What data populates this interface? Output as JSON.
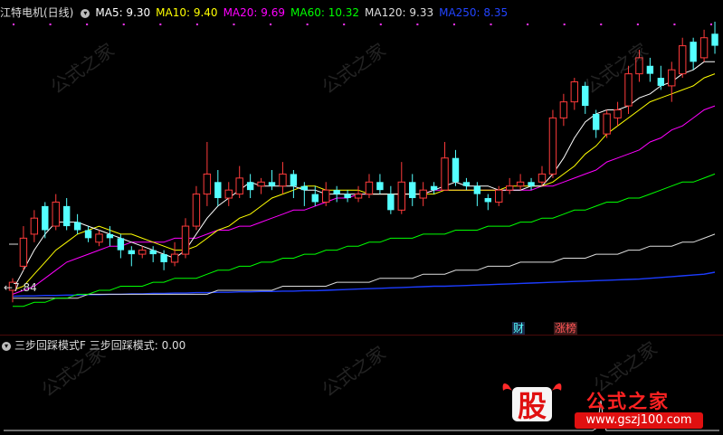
{
  "title": "江特电机(日线)",
  "ma_legend": [
    {
      "label": "MA5: 9.30",
      "color": "#ffffff"
    },
    {
      "label": "MA10: 9.40",
      "color": "#ffff00"
    },
    {
      "label": "MA20: 9.69",
      "color": "#ff00ff"
    },
    {
      "label": "MA60: 10.32",
      "color": "#00ff00"
    },
    {
      "label": "MA120: 9.33",
      "color": "#dddddd"
    },
    {
      "label": "MA250: 8.35",
      "color": "#1c3cff"
    }
  ],
  "low_label": "7.84",
  "markers": {
    "cai": "财",
    "zhang": "涨榜"
  },
  "sub": {
    "name": "三步回踩模式F",
    "label": "三步回踩模式: 0.00"
  },
  "brand": {
    "logo": "股",
    "name": "公式之家",
    "url": "www.gszj100.com"
  },
  "watermark": {
    "main": "公式之家",
    "sub": "www.gszj100.com"
  },
  "chart_data": {
    "type": "candlestick",
    "ylim": [
      7.2,
      14.6
    ],
    "colors": {
      "up": "#ff3b3b",
      "down": "#54ffff",
      "ma5": "#ffffff",
      "ma10": "#ffff00",
      "ma20": "#ff00ff",
      "ma60": "#00ff00",
      "ma120": "#dddddd",
      "ma250": "#1c3cff"
    },
    "candles": [
      [
        7.9,
        8.1,
        7.6,
        8.2
      ],
      [
        8.5,
        9.2,
        8.4,
        9.5
      ],
      [
        9.3,
        9.7,
        9.1,
        9.9
      ],
      [
        10.0,
        9.4,
        9.2,
        10.1
      ],
      [
        9.5,
        10.1,
        9.4,
        10.3
      ],
      [
        10.0,
        9.5,
        9.4,
        10.2
      ],
      [
        9.6,
        9.4,
        9.3,
        9.8
      ],
      [
        9.4,
        9.2,
        9.1,
        9.5
      ],
      [
        9.1,
        9.3,
        9.0,
        9.4
      ],
      [
        9.3,
        9.2,
        9.0,
        9.5
      ],
      [
        9.2,
        8.9,
        8.7,
        9.3
      ],
      [
        8.9,
        8.8,
        8.5,
        9.0
      ],
      [
        8.8,
        8.9,
        8.7,
        9.0
      ],
      [
        8.9,
        8.8,
        8.6,
        9.0
      ],
      [
        8.8,
        8.6,
        8.4,
        8.9
      ],
      [
        8.6,
        8.8,
        8.5,
        9.1
      ],
      [
        8.8,
        9.5,
        8.7,
        9.7
      ],
      [
        9.5,
        10.3,
        9.4,
        10.5
      ],
      [
        10.3,
        10.8,
        10.0,
        11.6
      ],
      [
        10.6,
        10.2,
        10.0,
        10.9
      ],
      [
        10.2,
        10.4,
        10.0,
        10.6
      ],
      [
        10.3,
        10.7,
        10.2,
        11.0
      ],
      [
        10.6,
        10.4,
        10.2,
        10.8
      ],
      [
        10.5,
        10.6,
        10.3,
        10.7
      ],
      [
        10.6,
        10.5,
        10.4,
        10.9
      ],
      [
        10.5,
        10.8,
        10.3,
        11.1
      ],
      [
        10.8,
        10.5,
        10.2,
        10.9
      ],
      [
        10.5,
        10.4,
        10.0,
        10.6
      ],
      [
        10.3,
        10.1,
        10.0,
        10.5
      ],
      [
        10.1,
        10.4,
        10.0,
        10.6
      ],
      [
        10.4,
        10.3,
        10.1,
        10.5
      ],
      [
        10.3,
        10.2,
        10.1,
        10.4
      ],
      [
        10.2,
        10.3,
        10.1,
        10.5
      ],
      [
        10.3,
        10.6,
        10.2,
        10.8
      ],
      [
        10.6,
        10.4,
        10.3,
        10.8
      ],
      [
        10.3,
        9.9,
        9.8,
        10.5
      ],
      [
        9.9,
        10.6,
        9.8,
        11.1
      ],
      [
        10.6,
        10.2,
        10.0,
        10.8
      ],
      [
        10.2,
        10.4,
        10.0,
        10.6
      ],
      [
        10.5,
        10.4,
        10.3,
        10.6
      ],
      [
        10.4,
        11.2,
        10.4,
        11.6
      ],
      [
        11.2,
        10.6,
        10.5,
        11.4
      ],
      [
        10.6,
        10.5,
        10.4,
        10.7
      ],
      [
        10.5,
        10.3,
        10.0,
        10.6
      ],
      [
        10.2,
        10.1,
        9.9,
        10.3
      ],
      [
        10.1,
        10.4,
        10.0,
        10.5
      ],
      [
        10.4,
        10.5,
        10.3,
        10.7
      ],
      [
        10.5,
        10.6,
        10.4,
        10.8
      ],
      [
        10.6,
        10.5,
        10.4,
        10.7
      ],
      [
        10.6,
        10.8,
        10.5,
        11.0
      ],
      [
        10.8,
        12.2,
        10.7,
        12.4
      ],
      [
        12.2,
        12.6,
        12.0,
        12.8
      ],
      [
        12.6,
        13.1,
        12.4,
        13.2
      ],
      [
        13.0,
        12.5,
        12.3,
        13.1
      ],
      [
        12.3,
        11.9,
        11.7,
        12.4
      ],
      [
        11.8,
        12.3,
        11.7,
        12.4
      ],
      [
        12.2,
        12.4,
        12.0,
        12.6
      ],
      [
        12.5,
        13.3,
        12.3,
        13.5
      ],
      [
        13.3,
        13.7,
        13.1,
        13.9
      ],
      [
        13.5,
        13.3,
        13.1,
        13.7
      ],
      [
        13.2,
        13.0,
        12.9,
        13.5
      ],
      [
        13.0,
        13.4,
        12.6,
        13.6
      ],
      [
        13.3,
        14.0,
        13.2,
        14.2
      ],
      [
        14.1,
        13.6,
        13.4,
        14.2
      ],
      [
        13.7,
        14.2,
        13.6,
        14.4
      ],
      [
        14.3,
        14.0,
        13.8,
        14.6
      ]
    ],
    "ma_series": {
      "ma5": [
        7.9,
        8.4,
        8.9,
        9.3,
        9.6,
        9.6,
        9.6,
        9.5,
        9.4,
        9.3,
        9.2,
        9.1,
        9.0,
        8.9,
        8.8,
        8.7,
        8.9,
        9.3,
        9.7,
        10.0,
        10.2,
        10.4,
        10.6,
        10.5,
        10.5,
        10.5,
        10.5,
        10.4,
        10.4,
        10.3,
        10.3,
        10.3,
        10.3,
        10.3,
        10.3,
        10.3,
        10.3,
        10.3,
        10.3,
        10.4,
        10.5,
        10.6,
        10.5,
        10.5,
        10.5,
        10.4,
        10.4,
        10.4,
        10.5,
        10.5,
        10.8,
        11.2,
        11.7,
        12.1,
        12.3,
        12.4,
        12.4,
        12.5,
        12.7,
        12.8,
        13.0,
        13.1,
        13.3,
        13.4,
        13.6,
        13.6
      ],
      "ma10": [
        7.9,
        8.0,
        8.3,
        8.6,
        8.9,
        9.1,
        9.3,
        9.4,
        9.5,
        9.4,
        9.3,
        9.3,
        9.2,
        9.1,
        9.0,
        8.9,
        8.9,
        9.0,
        9.2,
        9.4,
        9.5,
        9.7,
        9.8,
        10.0,
        10.2,
        10.3,
        10.4,
        10.5,
        10.5,
        10.4,
        10.4,
        10.4,
        10.4,
        10.3,
        10.3,
        10.3,
        10.3,
        10.3,
        10.3,
        10.3,
        10.4,
        10.4,
        10.4,
        10.4,
        10.4,
        10.4,
        10.5,
        10.5,
        10.5,
        10.5,
        10.6,
        10.8,
        11.0,
        11.3,
        11.5,
        11.8,
        12.0,
        12.2,
        12.4,
        12.6,
        12.7,
        12.8,
        12.9,
        13.0,
        13.2,
        13.3
      ],
      "ma20": [
        7.8,
        7.9,
        8.0,
        8.2,
        8.4,
        8.6,
        8.7,
        8.8,
        8.9,
        9.0,
        9.0,
        9.1,
        9.1,
        9.1,
        9.1,
        9.2,
        9.2,
        9.2,
        9.3,
        9.4,
        9.4,
        9.5,
        9.5,
        9.6,
        9.7,
        9.8,
        9.9,
        9.9,
        10.0,
        10.1,
        10.2,
        10.2,
        10.3,
        10.3,
        10.3,
        10.3,
        10.3,
        10.3,
        10.3,
        10.4,
        10.4,
        10.4,
        10.4,
        10.4,
        10.4,
        10.4,
        10.4,
        10.4,
        10.4,
        10.5,
        10.5,
        10.6,
        10.7,
        10.8,
        10.9,
        11.1,
        11.2,
        11.3,
        11.4,
        11.6,
        11.7,
        11.9,
        12.0,
        12.2,
        12.4,
        12.5
      ],
      "ma60": [
        7.5,
        7.5,
        7.6,
        7.6,
        7.7,
        7.7,
        7.8,
        7.8,
        7.9,
        7.9,
        8.0,
        8.0,
        8.0,
        8.1,
        8.1,
        8.2,
        8.2,
        8.2,
        8.3,
        8.4,
        8.4,
        8.5,
        8.5,
        8.6,
        8.6,
        8.7,
        8.7,
        8.8,
        8.8,
        8.9,
        8.9,
        9.0,
        9.0,
        9.1,
        9.1,
        9.2,
        9.2,
        9.2,
        9.3,
        9.3,
        9.3,
        9.4,
        9.4,
        9.4,
        9.5,
        9.5,
        9.5,
        9.6,
        9.6,
        9.7,
        9.7,
        9.8,
        9.9,
        9.9,
        10.0,
        10.1,
        10.1,
        10.2,
        10.2,
        10.3,
        10.4,
        10.5,
        10.6,
        10.6,
        10.7,
        10.8
      ],
      "ma120": [
        7.7,
        7.7,
        7.7,
        7.7,
        7.7,
        7.7,
        7.7,
        7.8,
        7.8,
        7.8,
        7.8,
        7.8,
        7.8,
        7.8,
        7.8,
        7.8,
        7.8,
        7.8,
        7.8,
        7.9,
        7.9,
        7.9,
        7.9,
        7.9,
        7.9,
        8.0,
        8.0,
        8.0,
        8.0,
        8.0,
        8.1,
        8.1,
        8.1,
        8.1,
        8.2,
        8.2,
        8.2,
        8.2,
        8.3,
        8.3,
        8.3,
        8.4,
        8.4,
        8.4,
        8.5,
        8.5,
        8.5,
        8.6,
        8.6,
        8.6,
        8.6,
        8.7,
        8.7,
        8.7,
        8.8,
        8.8,
        8.8,
        8.9,
        8.9,
        9.0,
        9.0,
        9.0,
        9.1,
        9.1,
        9.2,
        9.3
      ],
      "ma250": [
        7.75,
        7.76,
        7.76,
        7.77,
        7.77,
        7.78,
        7.78,
        7.79,
        7.79,
        7.8,
        7.8,
        7.81,
        7.81,
        7.82,
        7.82,
        7.83,
        7.83,
        7.84,
        7.84,
        7.85,
        7.85,
        7.86,
        7.86,
        7.87,
        7.87,
        7.88,
        7.88,
        7.89,
        7.89,
        7.9,
        7.91,
        7.92,
        7.93,
        7.94,
        7.95,
        7.96,
        7.97,
        7.98,
        7.99,
        8.0,
        8.0,
        8.01,
        8.02,
        8.03,
        8.04,
        8.05,
        8.06,
        8.07,
        8.08,
        8.09,
        8.1,
        8.11,
        8.12,
        8.13,
        8.14,
        8.15,
        8.16,
        8.17,
        8.18,
        8.2,
        8.22,
        8.24,
        8.26,
        8.28,
        8.3,
        8.35
      ]
    },
    "signal_dots_count": 20
  }
}
